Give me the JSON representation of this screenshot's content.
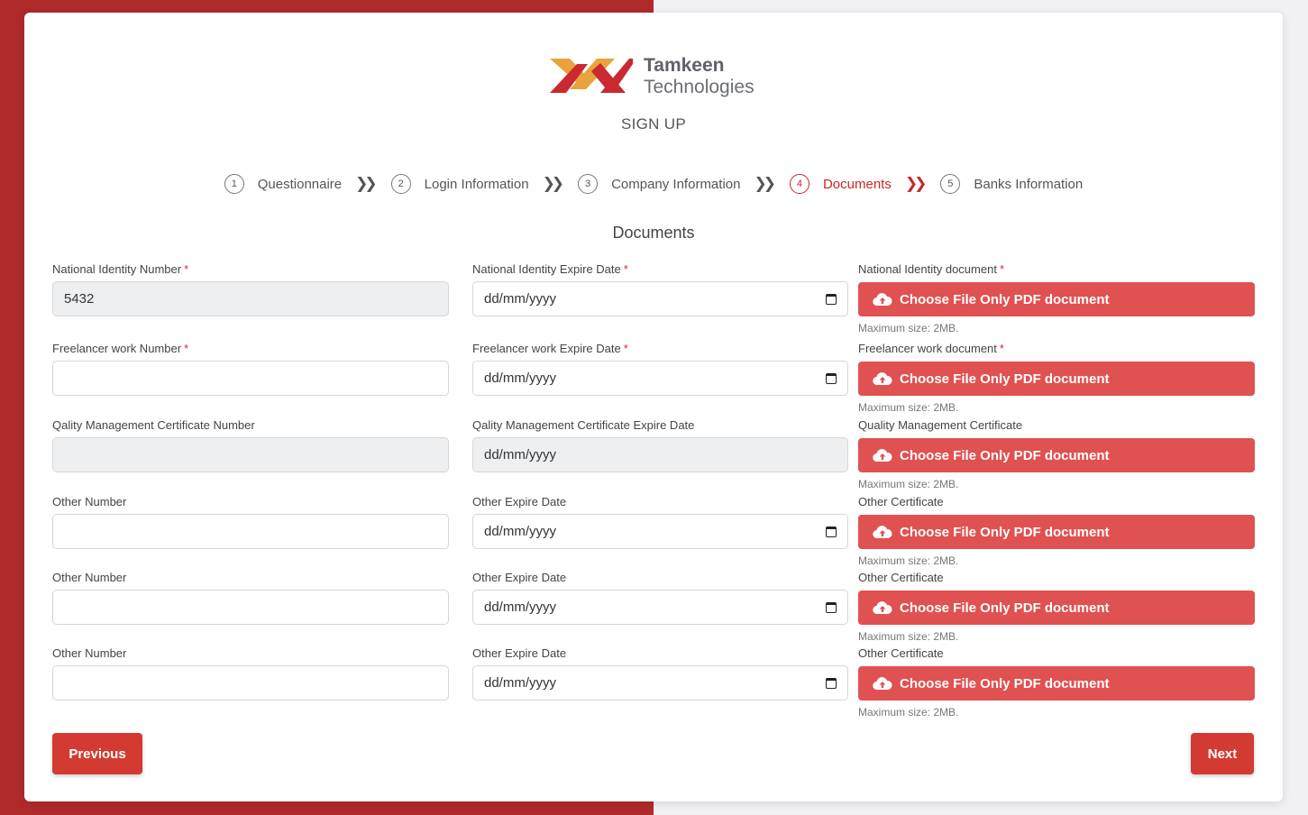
{
  "brand": {
    "line1": "Tamkeen",
    "line2": "Technologies",
    "colors": {
      "orange": "#e8a33a",
      "red": "#c9292f"
    }
  },
  "page_title": "SIGN UP",
  "steps": [
    {
      "num": "1",
      "label": "Questionnaire"
    },
    {
      "num": "2",
      "label": "Login Information"
    },
    {
      "num": "3",
      "label": "Company Information"
    },
    {
      "num": "4",
      "label": "Documents"
    },
    {
      "num": "5",
      "label": "Banks Information"
    }
  ],
  "step_separator": "❯❯",
  "active_step": 4,
  "section_title": "Documents",
  "required_mark": "*",
  "rows": [
    {
      "number_label": "National Identity Number",
      "number_value": "5432",
      "expire_label": "National Identity Expire Date",
      "date_value": "dd/mm/yyyy",
      "doc_label": "National Identity document"
    },
    {
      "number_label": "Freelancer work Number",
      "number_value": "",
      "expire_label": "Freelancer work Expire Date",
      "date_value": "dd/mm/yyyy",
      "doc_label": "Freelancer work document"
    },
    {
      "number_label": "Qality Management Certificate Number",
      "number_value": "",
      "expire_label": "Qality Management Certificate Expire Date",
      "date_value": "dd/mm/yyyy",
      "doc_label": "Quality Management Certificate"
    },
    {
      "number_label": "Other Number",
      "number_value": "",
      "expire_label": "Other Expire Date",
      "date_value": "dd/mm/yyyy",
      "doc_label": "Other Certificate"
    },
    {
      "number_label": "Other Number",
      "number_value": "",
      "expire_label": "Other Expire Date",
      "date_value": "dd/mm/yyyy",
      "doc_label": "Other Certificate"
    },
    {
      "number_label": "Other Number",
      "number_value": "",
      "expire_label": "Other Expire Date",
      "date_value": "dd/mm/yyyy",
      "doc_label": "Other Certificate"
    }
  ],
  "file_button_label": "Choose File Only PDF document",
  "file_hint": "Maximum size: 2MB.",
  "upload_icon": "cloud-upload-icon",
  "calendar_icon": "calendar-icon",
  "buttons": {
    "previous": "Previous",
    "next": "Next"
  },
  "colors": {
    "primary": "#d33b32",
    "file_button": "#e05151",
    "active_step": "#c62828"
  }
}
